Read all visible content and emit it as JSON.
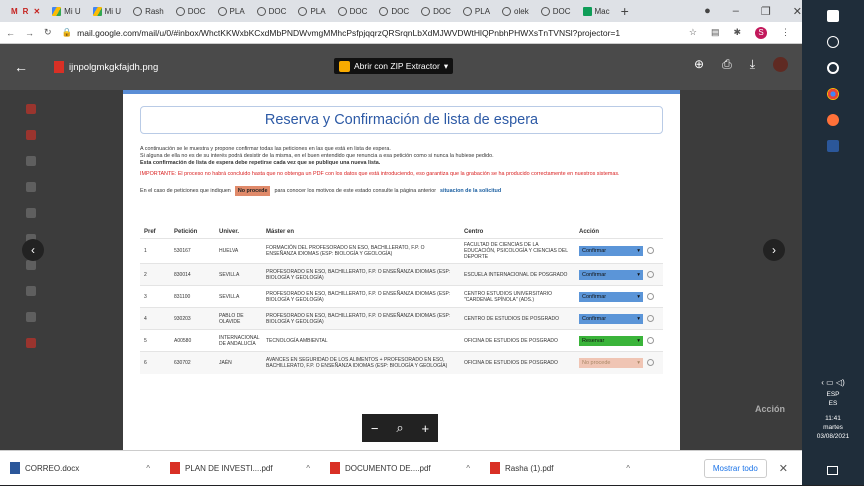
{
  "browser": {
    "tabs": [
      {
        "label": "M",
        "icon": "gmail-icon"
      },
      {
        "label": "Mi U",
        "icon": "drive-icon"
      },
      {
        "label": "Mi U",
        "icon": "drive-icon"
      },
      {
        "label": "Rash",
        "icon": "globe-icon"
      },
      {
        "label": "DOC",
        "icon": "globe-icon"
      },
      {
        "label": "PLA",
        "icon": "globe-icon"
      },
      {
        "label": "DOC",
        "icon": "globe-icon"
      },
      {
        "label": "PLA",
        "icon": "globe-icon"
      },
      {
        "label": "DOC",
        "icon": "globe-icon"
      },
      {
        "label": "DOC",
        "icon": "globe-icon"
      },
      {
        "label": "DOC",
        "icon": "globe-icon"
      },
      {
        "label": "PLA",
        "icon": "globe-icon"
      },
      {
        "label": "olek",
        "icon": "globe-icon"
      },
      {
        "label": "DOC",
        "icon": "globe-icon"
      },
      {
        "label": "Mac",
        "icon": "sheets-icon"
      }
    ],
    "url": "mail.google.com/mail/u/0/#inbox/WhctKKWxbKCxdMbPNDWvmgMMhcPsfpjqqrzQRSrqnLbXdMJWVDWtHlQPnbhPHWXsTnTVNSl?projector=1",
    "profile_initial": "S"
  },
  "viewer": {
    "filename": "ijnpolgmkgkfajdh.png",
    "open_with": "Abrir con ZIP Extractor",
    "bg_right_text": "Acción"
  },
  "doc": {
    "title": "Reserva y Confirmación de lista de espera",
    "intro_line1": "A continuación se le muestra y propone confirmar todas las peticiones en las que está en lista de espera.",
    "intro_line2": "Si alguna de ella no es de su interés podrá desistir de la misma, en el buen entendido que renuncia a esa petición como si nunca la hubiese pedido.",
    "intro_line3": "Esta confirmación de lista de espera debe repetirse cada vez que se publique una nueva lista.",
    "important": "IMPORTANTE: El proceso no habrá concluido hasta que no obtenga un PDF con los datos que está introduciendo, eso garantiza que la grabación se ha producido correctamente en nuestros sistemas.",
    "info_prefix": "En el caso de peticiones que indiquen",
    "info_badge": "No procede",
    "info_middle": "para conocer los motivos de este estado consulte la página anterior",
    "info_link": "situacion de la solicitud",
    "headers": [
      "Pref",
      "Petición",
      "Univer.",
      "Máster en",
      "Centro",
      "Acción"
    ],
    "rows": [
      {
        "pref": "1",
        "peticion": "530167",
        "univ": "HUELVA",
        "master": "FORMACIÓN DEL PROFESORADO EN ESO, BACHILLERATO, F.P. O ENSEÑANZA IDIOMAS (ESP: BIOLOGÍA Y GEOLOGÍA)",
        "centro": "FACULTAD DE CIENCIAS DE LA EDUCACIÓN, PSICOLOGÍA Y CIENCIAS DEL DEPORTE",
        "accion": "Confirmar",
        "state": "c"
      },
      {
        "pref": "2",
        "peticion": "830014",
        "univ": "SEVILLA",
        "master": "PROFESORADO EN ESO, BACHILLERATO, F.P. O ENSEÑANZA IDIOMAS (ESP: BIOLOGÍA Y GEOLOGÍA)",
        "centro": "ESCUELA INTERNACIONAL DE POSGRADO",
        "accion": "Confirmar",
        "state": "c"
      },
      {
        "pref": "3",
        "peticion": "831100",
        "univ": "SEVILLA",
        "master": "PROFESORADO EN ESO, BACHILLERATO, F.P. O ENSEÑANZA IDIOMAS (ESP: BIOLOGÍA Y GEOLOGÍA)",
        "centro": "CENTRO ESTUDIOS UNIVERSITARIO \"CARDENAL SPÍNOLA\" (ADS.)",
        "accion": "Confirmar",
        "state": "c"
      },
      {
        "pref": "4",
        "peticion": "930203",
        "univ": "PABLO DE OLAVIDE",
        "master": "PROFESORADO EN ESO, BACHILLERATO, F.P. O ENSEÑANZA IDIOMAS (ESP: BIOLOGÍA Y GEOLOGÍA)",
        "centro": "CENTRO DE ESTUDIOS DE POSGRADO",
        "accion": "Confirmar",
        "state": "c"
      },
      {
        "pref": "5",
        "peticion": "A00580",
        "univ": "INTERNACIONAL DE ANDALUCÍA",
        "master": "TECNOLOGÍA AMBIENTAL",
        "centro": "OFICINA DE ESTUDIOS DE POSGRADO",
        "accion": "Reservar",
        "state": "r"
      },
      {
        "pref": "6",
        "peticion": "630702",
        "univ": "JAÉN",
        "master": "AVANCES EN SEGURIDAD DE LOS ALIMENTOS + PROFESORADO EN ESO, BACHILLERATO, F.P. O ENSEÑANZA IDIOMAS (ESP: BIOLOGÍA Y GEOLOGÍA)",
        "centro": "OFICINA DE ESTUDIOS DE POSGRADO",
        "accion": "No procede",
        "state": "n"
      }
    ]
  },
  "downloads": {
    "items": [
      {
        "name": "CORREO.docx",
        "type": "w"
      },
      {
        "name": "PLAN DE INVESTI....pdf",
        "type": "p"
      },
      {
        "name": "DOCUMENTO DE....pdf",
        "type": "p"
      },
      {
        "name": "Rasha (1).pdf",
        "type": "p"
      }
    ],
    "show_all": "Mostrar todo"
  },
  "taskbar": {
    "lang": "ESP",
    "lang2": "ES",
    "time": "11:41",
    "day": "martes",
    "date": "03/08/2021"
  }
}
